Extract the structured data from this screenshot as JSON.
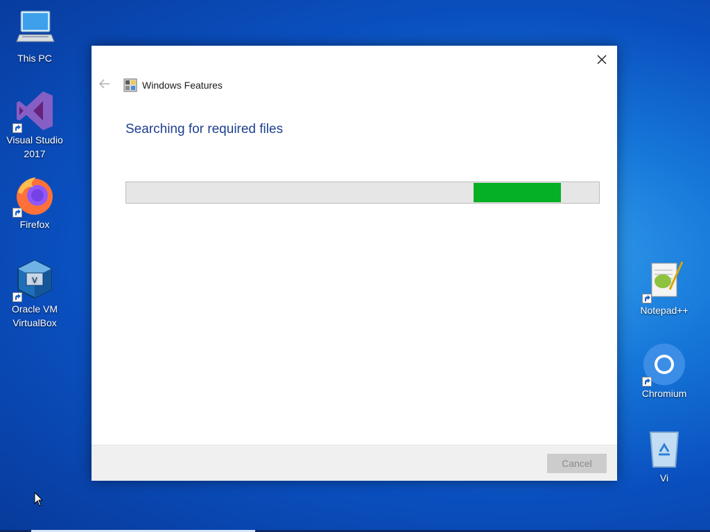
{
  "desktop": {
    "left_icons": [
      {
        "label": "This PC",
        "icon": "this-pc-icon"
      },
      {
        "label": "Visual Studio\n2017",
        "icon": "visual-studio-icon"
      },
      {
        "label": "Firefox",
        "icon": "firefox-icon"
      },
      {
        "label": "Oracle VM\nVirtualBox",
        "icon": "virtualbox-icon"
      }
    ],
    "right_icons": [
      {
        "label": "Notepad++",
        "icon": "notepadpp-icon"
      },
      {
        "label": "Chromium",
        "icon": "chromium-icon"
      },
      {
        "label": "Vi",
        "icon": "recycle-bin-icon"
      }
    ]
  },
  "dialog": {
    "title": "Windows Features",
    "heading": "Searching for required files",
    "progress": {
      "mode": "indeterminate",
      "segment_start": 0.735,
      "segment_end": 0.92,
      "color": "#06b025"
    },
    "cancel_label": "Cancel",
    "cancel_enabled": false
  }
}
